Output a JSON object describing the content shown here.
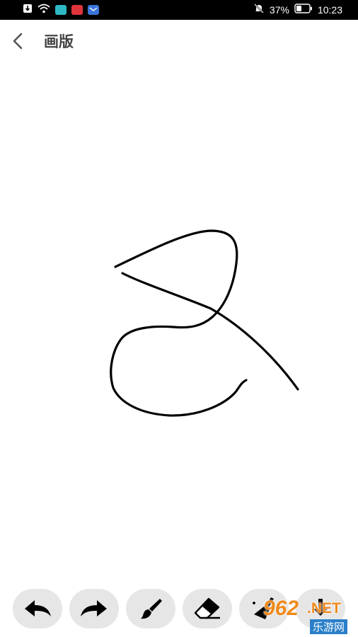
{
  "status_bar": {
    "battery_percent": "37%",
    "time": "10:23",
    "left_icons": [
      "download-notification-icon",
      "wifi-icon",
      "app-notification-icon",
      "app-notification-icon",
      "mail-notification-icon"
    ],
    "right_icons": [
      "mute-icon",
      "battery-icon"
    ]
  },
  "header": {
    "title": "画版",
    "back_icon": "chevron-left-icon"
  },
  "toolbar": {
    "tools": [
      {
        "name": "undo",
        "icon": "undo-arrow-icon"
      },
      {
        "name": "redo",
        "icon": "redo-arrow-icon"
      },
      {
        "name": "brush",
        "icon": "brush-icon"
      },
      {
        "name": "eraser",
        "icon": "eraser-icon"
      },
      {
        "name": "clear",
        "icon": "broom-icon"
      },
      {
        "name": "save",
        "icon": "save-icon"
      }
    ]
  },
  "watermark": {
    "brand": "962",
    "suffix": ".NET",
    "subtitle": "乐游网"
  },
  "colors": {
    "status_bar_bg": "#000000",
    "toolbar_button_bg": "#e6e6e6",
    "stroke": "#000000",
    "title": "#444444",
    "watermark_orange": "#f08a1c"
  }
}
